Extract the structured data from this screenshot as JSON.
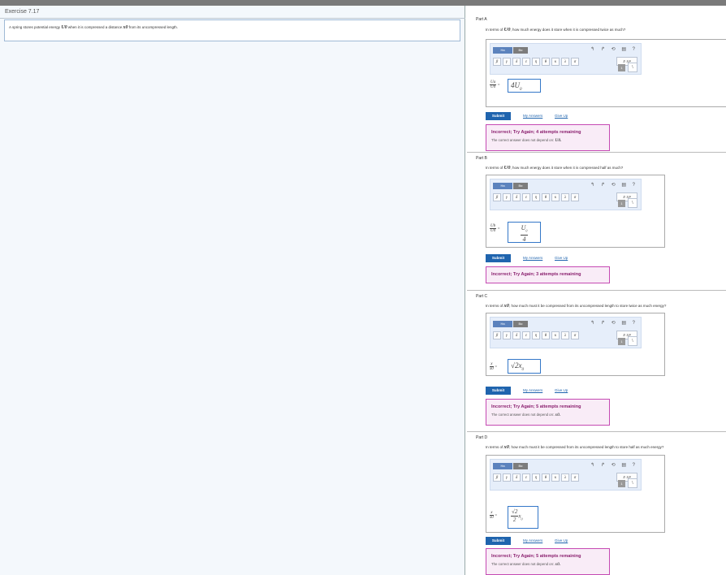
{
  "exercise": {
    "title": "Exercise 7.17",
    "intro_prefix": "A spring stores potential energy",
    "intro_var1": "U0",
    "intro_mid": "when it is compressed a distance",
    "intro_var2": "x0",
    "intro_suffix": "from its uncompressed length."
  },
  "toolbar": {
    "template_tab": "Ha",
    "greek_tab": "Bα",
    "tools": "↰ ↱ ⟲ ▤ ?",
    "greek_keys": [
      "β",
      "γ",
      "δ",
      "ε",
      "η",
      "θ",
      "κ",
      "λ",
      "σ",
      "χ",
      "π"
    ],
    "sci_key": "X·10ⁿ",
    "gray_key": "1",
    "white_key": "\\"
  },
  "buttons": {
    "submit": "Submit",
    "my_answers": "My Answers",
    "give_up": "Give Up"
  },
  "parts": [
    {
      "label": "Part A",
      "question_prefix": "In terms of",
      "question_var": "U0",
      "question_suffix": ", how much energy does it store when it is compressed twice as much?",
      "eq_num": "Ua",
      "eq_den": "U0",
      "answer": "4U",
      "answer_sub": "0",
      "feedback_title": "Incorrect; Try Again; 4 attempts remaining",
      "feedback_text": "The correct answer does not depend on:",
      "feedback_var": "U0."
    },
    {
      "label": "Part B",
      "question_prefix": "In terms of",
      "question_var": "U0",
      "question_suffix": ", how much energy does it store when it is compressed half as much?",
      "eq_num": "Ub",
      "eq_den": "U0",
      "answer_num": "U",
      "answer_sub": "0",
      "answer_den": "4",
      "feedback_title": "Incorrect; Try Again; 3 attempts remaining"
    },
    {
      "label": "Part C",
      "question_prefix": "In terms of",
      "question_var": "x0",
      "question_suffix": ", how much must it be compressed from its uncompressed length to store twice as much energy?",
      "eq_num": "x",
      "eq_den": "x0",
      "answer": "√2x",
      "answer_sub": "0",
      "feedback_title": "Incorrect; Try Again; 5 attempts remaining",
      "feedback_text": "The correct answer does not depend on:",
      "feedback_var": "x0."
    },
    {
      "label": "Part D",
      "question_prefix": "In terms of",
      "question_var": "x0",
      "question_suffix": ", how much must it be compressed from its uncompressed length to store half as much energy?",
      "eq_num": "x",
      "eq_den": "x0",
      "answer_num": "√2",
      "answer_den": "2",
      "answer_tail": "x",
      "answer_sub": "0",
      "feedback_title": "Incorrect; Try Again; 5 attempts remaining",
      "feedback_text": "The correct answer does not depend on:",
      "feedback_var": "x0."
    }
  ],
  "colors": {
    "accent": "#1f64ae",
    "feedback_border": "#c54ab3",
    "feedback_bg": "#f9ecf7",
    "input_border": "#3477c8"
  }
}
